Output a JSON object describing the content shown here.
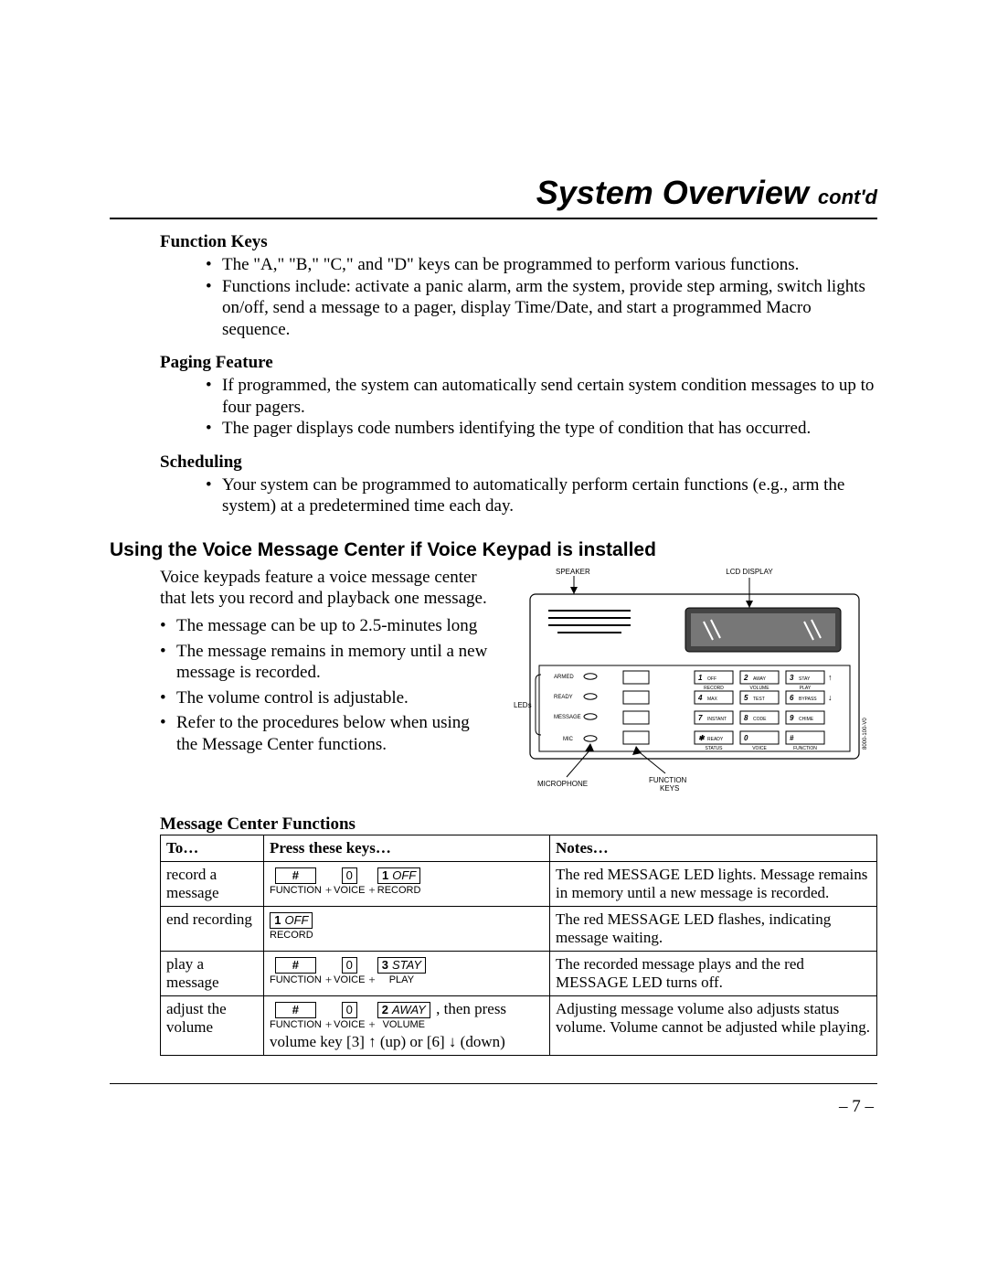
{
  "title": "System Overview",
  "title_sub": "cont'd",
  "sections": {
    "function_keys": {
      "heading": "Function Keys",
      "bullets": [
        "The \"A,\" \"B,\" \"C,\" and \"D\" keys can be programmed to perform various functions.",
        "Functions include: activate a panic alarm, arm the system, provide step arming, switch lights on/off, send a message to a pager, display Time/Date, and start a programmed Macro sequence."
      ]
    },
    "paging": {
      "heading": "Paging Feature",
      "bullets": [
        "If programmed, the system can automatically send certain system condition messages to up to four pagers.",
        "The pager displays code numbers identifying the type of condition that has occurred."
      ]
    },
    "scheduling": {
      "heading": "Scheduling",
      "bullets": [
        "Your system can be programmed to automatically perform certain functions (e.g., arm the system) at a predetermined time each day."
      ]
    }
  },
  "voice_center": {
    "heading": "Using the Voice Message Center if Voice Keypad is installed",
    "intro": "Voice keypads feature a voice message center that lets you record and playback one message.",
    "bullets": [
      "The message can be up to 2.5-minutes long",
      "The message remains in memory until a new message is recorded.",
      "The volume control is adjustable.",
      "Refer to the procedures below when using the Message Center functions."
    ]
  },
  "keypad_diagram": {
    "labels": {
      "speaker": "SPEAKER",
      "lcd": "LCD DISPLAY",
      "leds": "LEDs",
      "armed": "ARMED",
      "ready": "READY",
      "message": "MESSAGE",
      "mic_label": "MIC",
      "microphone": "MICROPHONE",
      "function_keys": "FUNCTION KEYS"
    },
    "keys": [
      {
        "n": "1",
        "t": "OFF"
      },
      {
        "n": "2",
        "t": "AWAY"
      },
      {
        "n": "3",
        "t": "STAY"
      },
      {
        "n": "4",
        "t": "MAX"
      },
      {
        "n": "5",
        "t": "TEST"
      },
      {
        "n": "6",
        "t": "BYPASS"
      },
      {
        "n": "7",
        "t": "INSTANT"
      },
      {
        "n": "8",
        "t": "CODE"
      },
      {
        "n": "9",
        "t": "CHIME"
      },
      {
        "n": "✱",
        "t": "READY"
      },
      {
        "n": "0",
        "t": ""
      },
      {
        "n": "#",
        "t": ""
      }
    ],
    "key_sublabels": {
      "row1": [
        "RECORD",
        "VOLUME",
        "PLAY"
      ],
      "row4": [
        "STATUS",
        "VOICE",
        "FUNCTION"
      ]
    },
    "side_id": "8000-100-V0"
  },
  "table": {
    "heading": "Message Center Functions",
    "headers": {
      "to": "To…",
      "press": "Press these keys…",
      "notes": "Notes…"
    },
    "rows": [
      {
        "to": "record a message",
        "keys_html": {
          "groups": [
            {
              "key": {
                "wide": true,
                "content": "#"
              },
              "sub": "FUNCTION"
            },
            {
              "plus": true
            },
            {
              "key": {
                "content": "0"
              },
              "sub": "VOICE"
            },
            {
              "plus": true
            },
            {
              "key": {
                "num": "1",
                "label": "OFF"
              },
              "sub": "RECORD"
            }
          ]
        },
        "notes": "The red MESSAGE LED lights. Message remains in memory until a new message is recorded."
      },
      {
        "to": "end recording",
        "keys_html": {
          "groups": [
            {
              "key": {
                "num": "1",
                "label": "OFF"
              },
              "sub": "RECORD"
            }
          ]
        },
        "notes": "The red MESSAGE LED flashes, indicating message waiting."
      },
      {
        "to": "play a message",
        "keys_html": {
          "groups": [
            {
              "key": {
                "wide": true,
                "content": "#"
              },
              "sub": "FUNCTION"
            },
            {
              "plus": true
            },
            {
              "key": {
                "content": "0"
              },
              "sub": "VOICE"
            },
            {
              "plus": true
            },
            {
              "key": {
                "num": "3",
                "label": "STAY"
              },
              "sub": "PLAY"
            }
          ]
        },
        "notes": "The recorded message plays and the red MESSAGE LED turns off."
      },
      {
        "to": "adjust the volume",
        "keys_html": {
          "groups": [
            {
              "key": {
                "wide": true,
                "content": "#"
              },
              "sub": "FUNCTION"
            },
            {
              "plus": true
            },
            {
              "key": {
                "content": "0"
              },
              "sub": "VOICE"
            },
            {
              "plus": true
            },
            {
              "key": {
                "num": "2",
                "label": "AWAY"
              },
              "sub": "VOLUME"
            }
          ],
          "suffix_text": " , then press",
          "footer": "volume key [3] ↑ (up) or [6] ↓ (down)"
        },
        "notes": "Adjusting message volume also adjusts status volume. Volume cannot be adjusted while playing."
      }
    ]
  },
  "page_number": "– 7 –"
}
